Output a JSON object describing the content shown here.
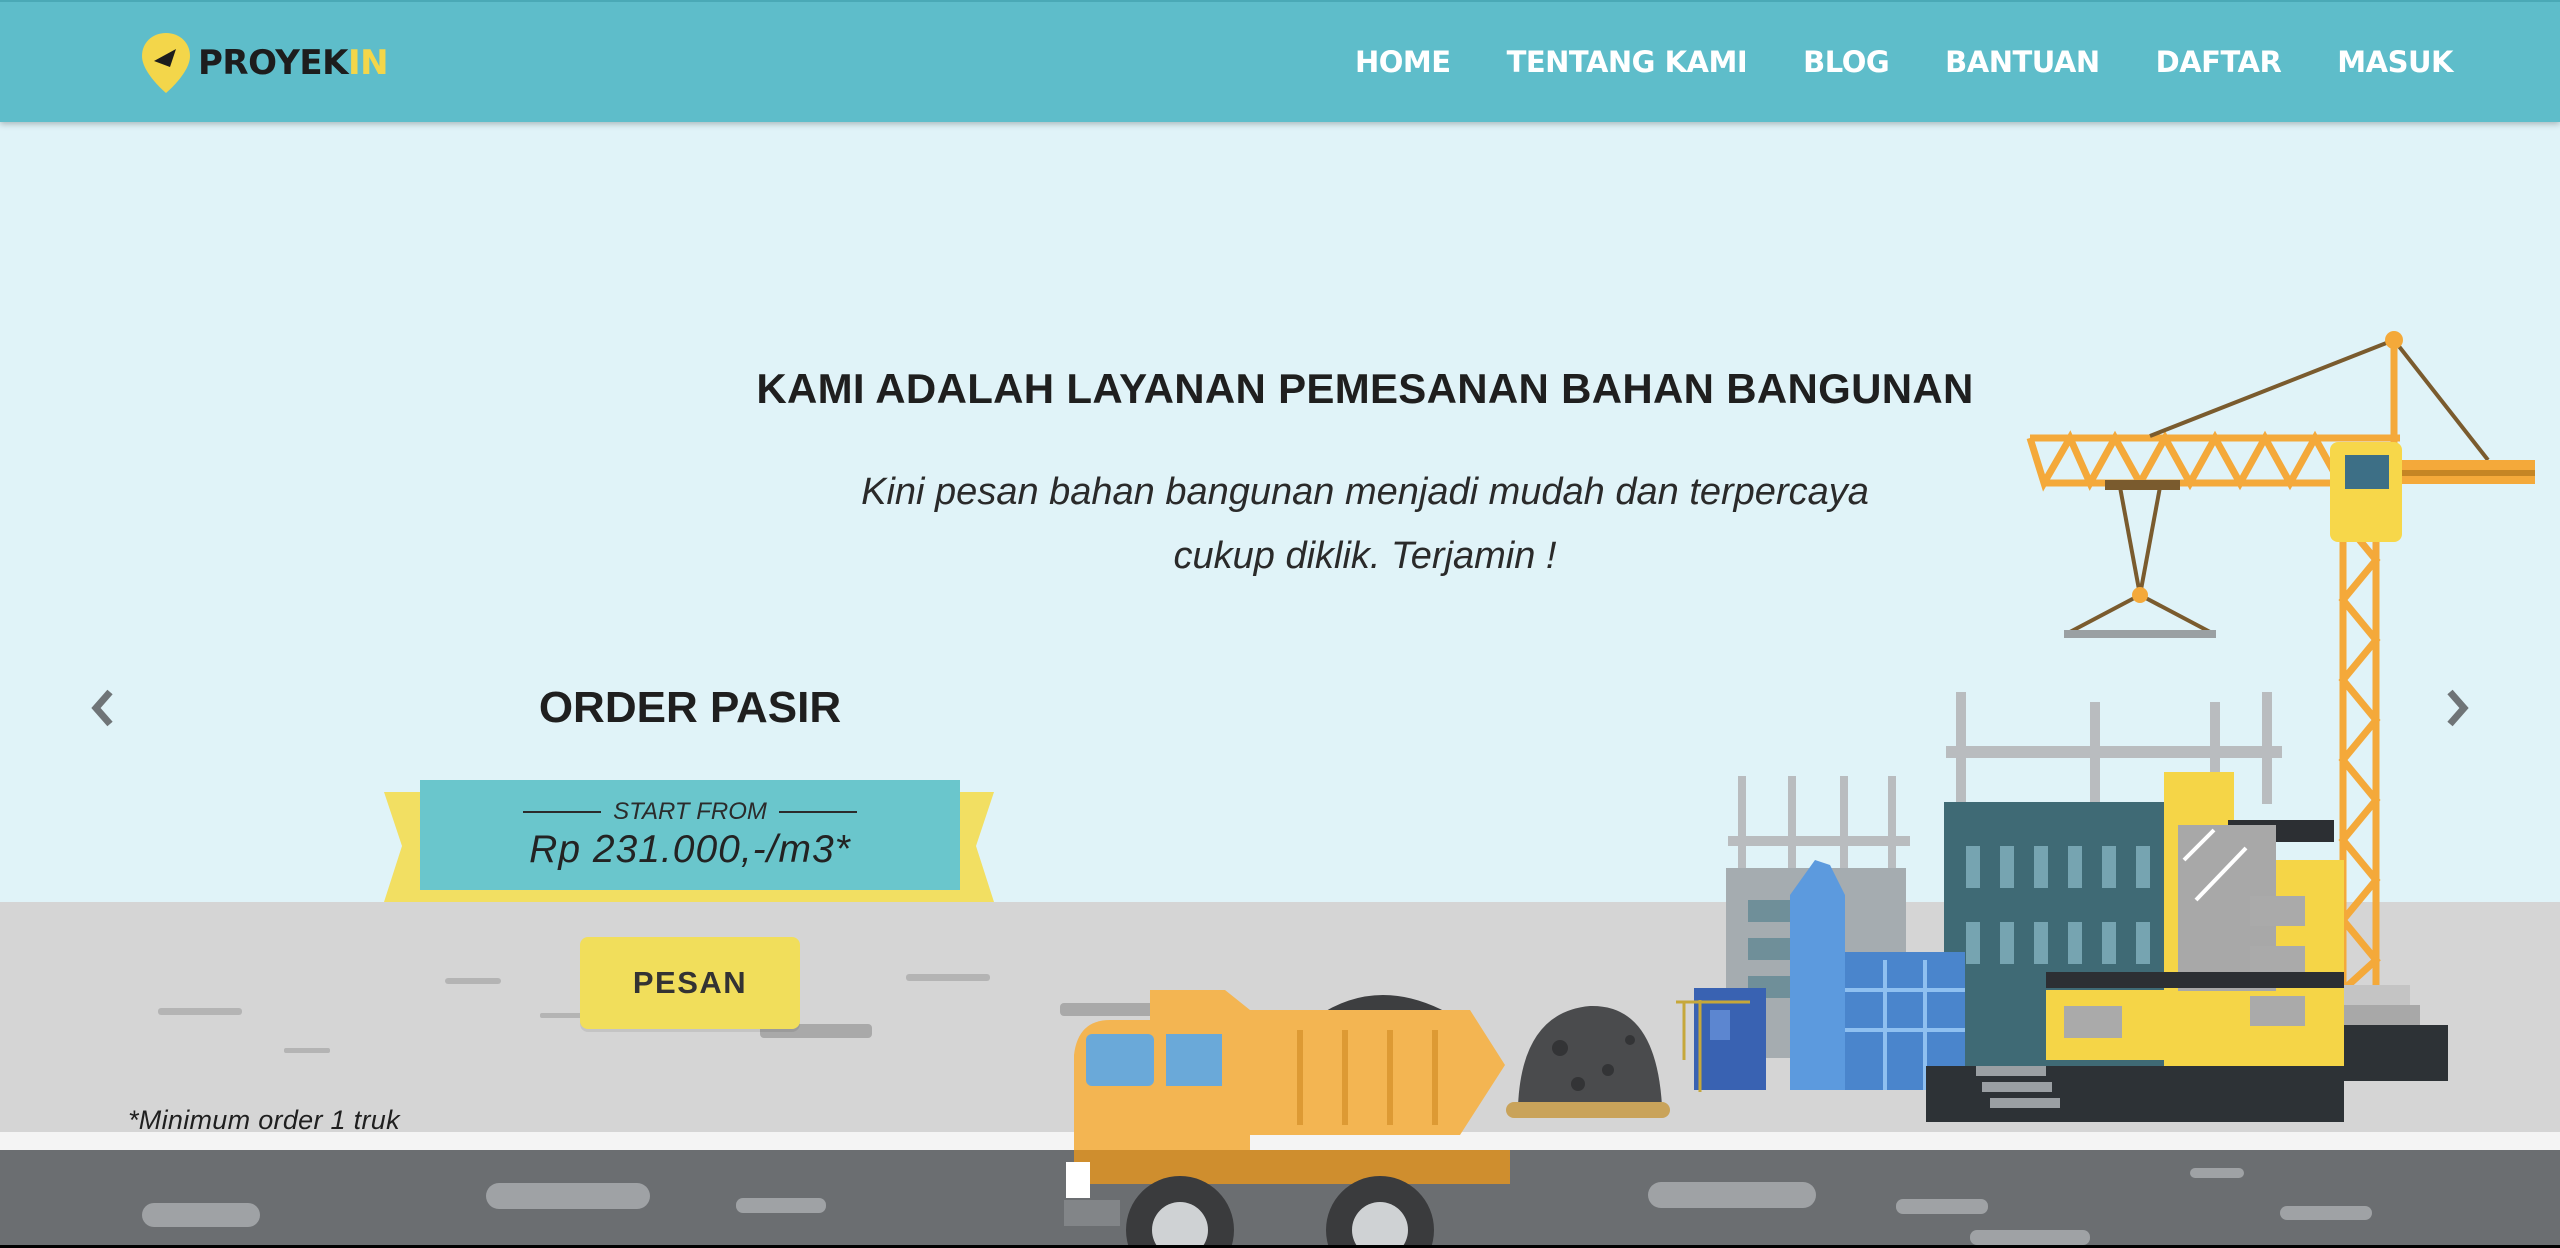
{
  "brand": {
    "name_main": "PROYEK",
    "name_accent": "IN",
    "logo_icon": "location-pin-icon"
  },
  "nav": {
    "items": [
      {
        "label": "HOME"
      },
      {
        "label": "TENTANG KAMI"
      },
      {
        "label": "BLOG"
      },
      {
        "label": "BANTUAN"
      },
      {
        "label": "DAFTAR"
      },
      {
        "label": "MASUK"
      }
    ]
  },
  "hero": {
    "title": "KAMI ADALAH LAYANAN PEMESANAN BAHAN BANGUNAN",
    "subtitle_line1": "Kini pesan bahan bangunan menjadi mudah dan terpercaya",
    "subtitle_line2": "cukup diklik. Terjamin !"
  },
  "slide": {
    "product_title": "ORDER PASIR",
    "price_label": "START FROM",
    "price_value": "Rp 231.000,-/m3*",
    "order_button": "PESAN",
    "footnote": "*Minimum order 1 truk"
  },
  "carousel": {
    "prev_icon": "chevron-left-icon",
    "next_icon": "chevron-right-icon"
  },
  "colors": {
    "navbar": "#5ebdca",
    "sky": "#e0f3f8",
    "ground": "#d5d5d5",
    "road": "#6c6f71",
    "accent_yellow": "#f1de5b",
    "price_box": "#6ac6cc",
    "crane": "#f4a93a"
  }
}
